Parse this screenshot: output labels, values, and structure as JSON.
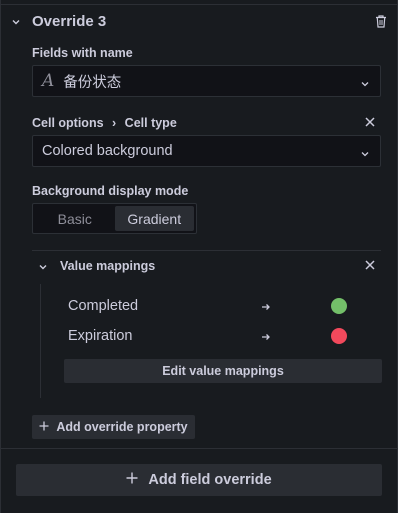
{
  "override": {
    "title": "Override 3",
    "fields_label": "Fields with name",
    "field_name": "备份状态",
    "field_type_glyph": "A",
    "breadcrumb_parent": "Cell options",
    "breadcrumb_sep": "›",
    "breadcrumb_child": "Cell type",
    "cell_type_value": "Colored background",
    "bg_mode_label": "Background display mode",
    "bg_mode_options": [
      "Basic",
      "Gradient"
    ],
    "bg_mode_selected": "Gradient"
  },
  "value_mappings": {
    "title": "Value mappings",
    "items": [
      {
        "name": "Completed",
        "color": "#73bf69"
      },
      {
        "name": "Expiration",
        "color": "#f2495c"
      }
    ],
    "edit_label": "Edit value mappings"
  },
  "add_override_property_label": "Add override property",
  "add_field_override_label": "Add field override",
  "colors": {
    "background": "#181b1f",
    "completed": "#73bf69",
    "expiration": "#f2495c"
  },
  "icons": [
    "chevron-down-icon",
    "trash-icon",
    "close-icon",
    "arrow-right-icon",
    "plus-icon"
  ]
}
